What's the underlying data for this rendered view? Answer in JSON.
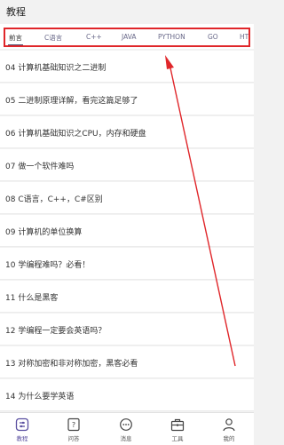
{
  "header": {
    "title": "教程"
  },
  "tabs": [
    {
      "label": "前言",
      "active": true
    },
    {
      "label": "C语言"
    },
    {
      "label": "C++"
    },
    {
      "label": "JAVA"
    },
    {
      "label": "PYTHON"
    },
    {
      "label": "GO"
    },
    {
      "label": "HT"
    }
  ],
  "list": [
    "04 计算机基础知识之二进制",
    "05 二进制原理详解，看完这篇足够了",
    "06 计算机基础知识之CPU，内存和硬盘",
    "07 做一个软件难吗",
    "08 C语言，C++，C#区别",
    "09 计算机的单位换算",
    "10 学编程难吗？必看！",
    "11 什么是黑客",
    "12 学编程一定要会英语吗？",
    "13 对称加密和非对称加密，黑客必看",
    "14 为什么要学英语"
  ],
  "bottom_nav": [
    {
      "label": "教程",
      "icon": "tutorial-icon",
      "active": true
    },
    {
      "label": "问答",
      "icon": "qa-icon"
    },
    {
      "label": "消息",
      "icon": "message-icon"
    },
    {
      "label": "工具",
      "icon": "toolbox-icon"
    },
    {
      "label": "我的",
      "icon": "profile-icon"
    }
  ],
  "colors": {
    "accent": "#5a4fa0",
    "annotation": "#e0262a"
  }
}
